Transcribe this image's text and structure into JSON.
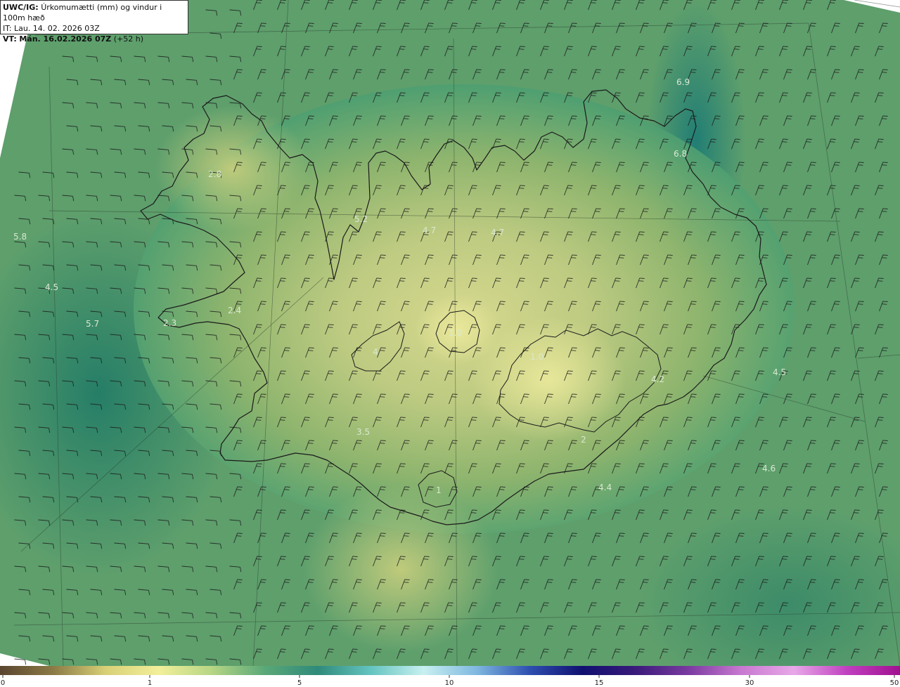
{
  "header": {
    "model": "UWC/IG:",
    "title": "Úrkomumætti (mm) og vindur i 100m hæð",
    "init_time": "IT: Lau. 14. 02. 2026 03Z",
    "valid_prefix": "VT:",
    "valid_time": "Mán. 16.02.2026 07Z",
    "lead": "(+52 h)"
  },
  "colorbar": {
    "ticks": [
      "0",
      "1",
      "5",
      "10",
      "15",
      "30",
      "50"
    ],
    "colors": [
      "#5a4530",
      "#8b7a45",
      "#d8d077",
      "#f2ef9a",
      "#b6d685",
      "#5aa878",
      "#2f8a7a",
      "#64c4c0",
      "#c8f0f0",
      "#7fb8e0",
      "#2f4fb0",
      "#101070",
      "#3a1a7a",
      "#7a3aa0",
      "#c878d0",
      "#e8a8e8",
      "#c040c0",
      "#a01090"
    ]
  },
  "map": {
    "value_labels": [
      "6.9",
      "6.8",
      "2.8",
      "5.2",
      "4.7",
      "4.7",
      "5.8",
      "4.5",
      "2.4",
      "5.7",
      "2.3",
      "1.0",
      "4",
      "1.0",
      "4.2",
      "4.5",
      "3.5",
      "2",
      "4.6",
      "4.4",
      "1"
    ],
    "colors": {
      "sea": "#2d8a70",
      "sea_light": "#4a9a72",
      "land_mid": "#8fb26c",
      "land_light": "#d8d98a",
      "coast": "#1a1a1a"
    }
  }
}
